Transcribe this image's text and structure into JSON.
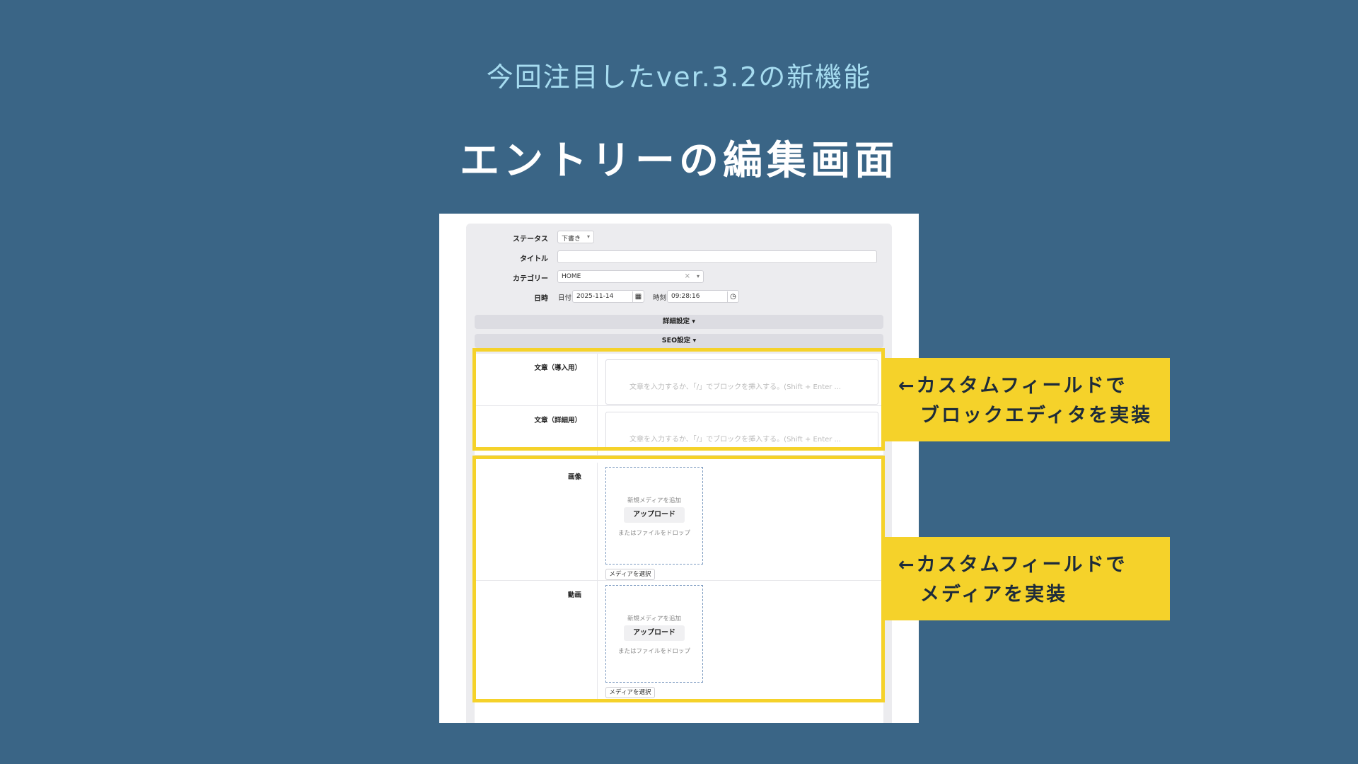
{
  "slide": {
    "subtitle": "今回注目したver.3.2の新機能",
    "title": "エントリーの編集画面"
  },
  "form": {
    "status": {
      "label": "ステータス",
      "value": "下書き"
    },
    "title_field": {
      "label": "タイトル",
      "value": ""
    },
    "category": {
      "label": "カテゴリー",
      "value": "HOME"
    },
    "datetime": {
      "label": "日時",
      "date_label": "日付",
      "date_value": "2025-11-14",
      "time_label": "時刻",
      "time_value": "09:28:16"
    },
    "accordions": {
      "detail": "詳細設定",
      "seo": "SEO設定"
    }
  },
  "custom_fields": {
    "text_intro": {
      "label": "文章（導入用）",
      "placeholder": "文章を入力するか、「/」でブロックを挿入する。(Shift + Enter ..."
    },
    "text_detail": {
      "label": "文章（詳細用）",
      "placeholder": "文章を入力するか、「/」でブロックを挿入する。(Shift + Enter ..."
    },
    "image": {
      "label": "画像",
      "add_text": "新規メディアを追加",
      "upload_button": "アップロード",
      "drop_text": "またはファイルをドロップ",
      "select_button": "メディアを選択"
    },
    "video": {
      "label": "動画",
      "add_text": "新規メディアを追加",
      "upload_button": "アップロード",
      "drop_text": "またはファイルをドロップ",
      "select_button": "メディアを選択"
    }
  },
  "callouts": {
    "block_editor": {
      "line1": "←カスタムフィールドで",
      "line2": "ブロックエディタを実装"
    },
    "media": {
      "line1": "←カスタムフィールドで",
      "line2": "メディアを実装"
    }
  },
  "colors": {
    "background": "#3a6586",
    "subtitle": "#a6dcf0",
    "highlight": "#f5d22a"
  },
  "icons": {
    "dropdown": "chevron-down-icon",
    "clear": "close-icon",
    "calendar": "calendar-icon",
    "clock": "clock-icon"
  }
}
